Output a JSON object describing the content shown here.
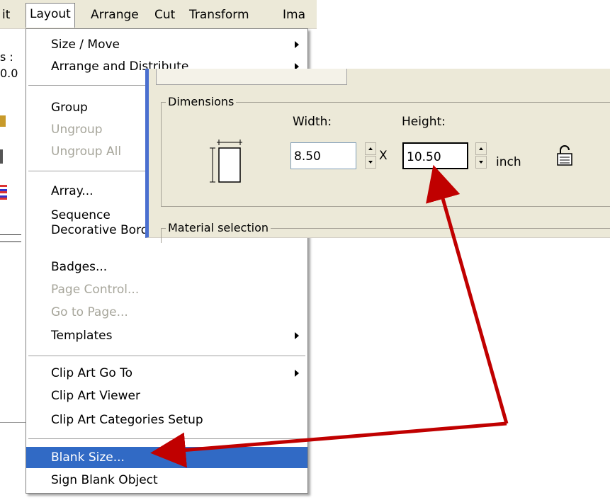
{
  "menubar": {
    "items": [
      "it",
      "Layout",
      "Arrange",
      "Cut",
      "Transform",
      "Ima"
    ]
  },
  "side_fragments": [
    "s :",
    "0.0"
  ],
  "menu": {
    "items": [
      {
        "label": "Size / Move",
        "submenu": true
      },
      {
        "label": "Arrange and Distribute",
        "submenu": true
      },
      {
        "label": "Group"
      },
      {
        "label": "Ungroup",
        "disabled": true
      },
      {
        "label": "Ungroup All",
        "disabled": true
      },
      {
        "label": "Array..."
      },
      {
        "label": "Sequence"
      },
      {
        "label": "Decorative Border..."
      },
      {
        "label": "Badges..."
      },
      {
        "label": "Page Control...",
        "disabled": true
      },
      {
        "label": "Go to Page...",
        "disabled": true
      },
      {
        "label": "Templates",
        "submenu": true
      },
      {
        "label": "Clip Art Go To",
        "submenu": true
      },
      {
        "label": "Clip Art Viewer"
      },
      {
        "label": "Clip Art Categories Setup"
      },
      {
        "label": "Blank Size...",
        "selected": true
      },
      {
        "label": "Sign Blank Object"
      }
    ]
  },
  "dialog": {
    "dimensions_title": "Dimensions",
    "width_label": "Width:",
    "height_label": "Height:",
    "width_value": "8.50",
    "height_value": "10.50",
    "times": "X",
    "unit": "inch",
    "material_title": "Material selection"
  },
  "colors": {
    "highlight": "#316ac5",
    "arrow": "#c00000",
    "dialog_accent": "#4a6fcf"
  }
}
